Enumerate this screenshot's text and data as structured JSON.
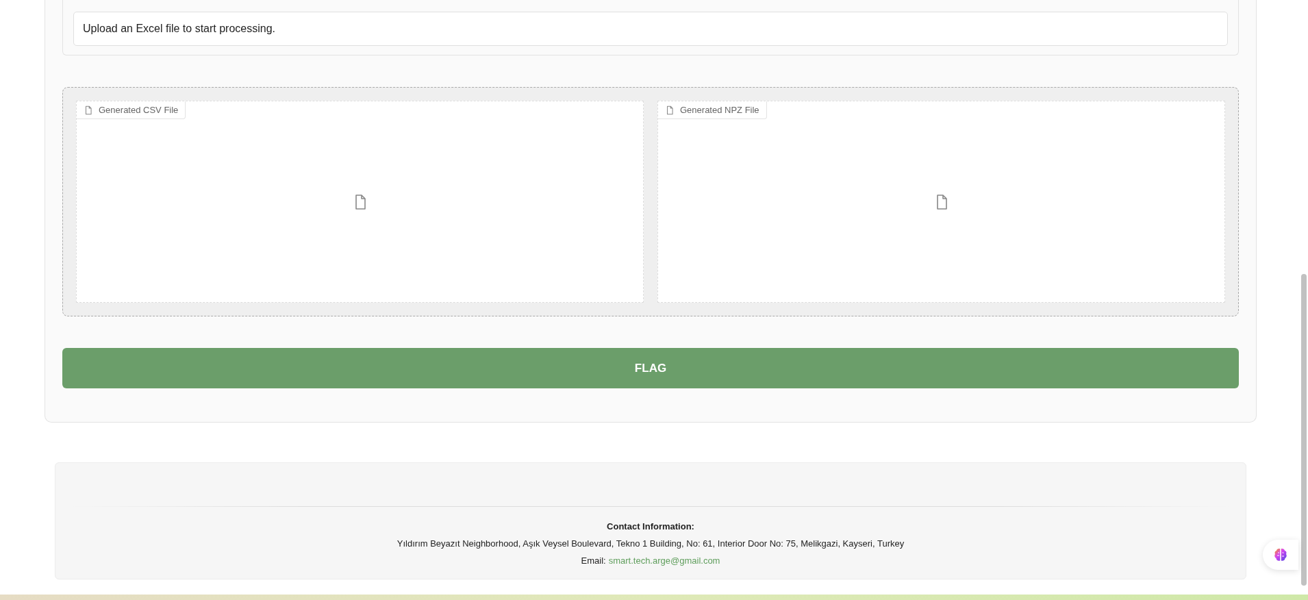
{
  "status": {
    "value": "Upload an Excel file to start processing."
  },
  "files": [
    {
      "label": "Generated CSV File"
    },
    {
      "label": "Generated NPZ File"
    }
  ],
  "flag_button": "FLAG",
  "footer": {
    "heading": "Contact Information:",
    "address": "Yıldırım Beyazıt Neighborhood, Aşık Veysel Boulevard, Tekno 1 Building, No: 61, Interior Door No: 75, Melikgazi, Kayseri, Turkey",
    "email_label": "Email:",
    "email": "smart.tech.arge@gmail.com"
  }
}
